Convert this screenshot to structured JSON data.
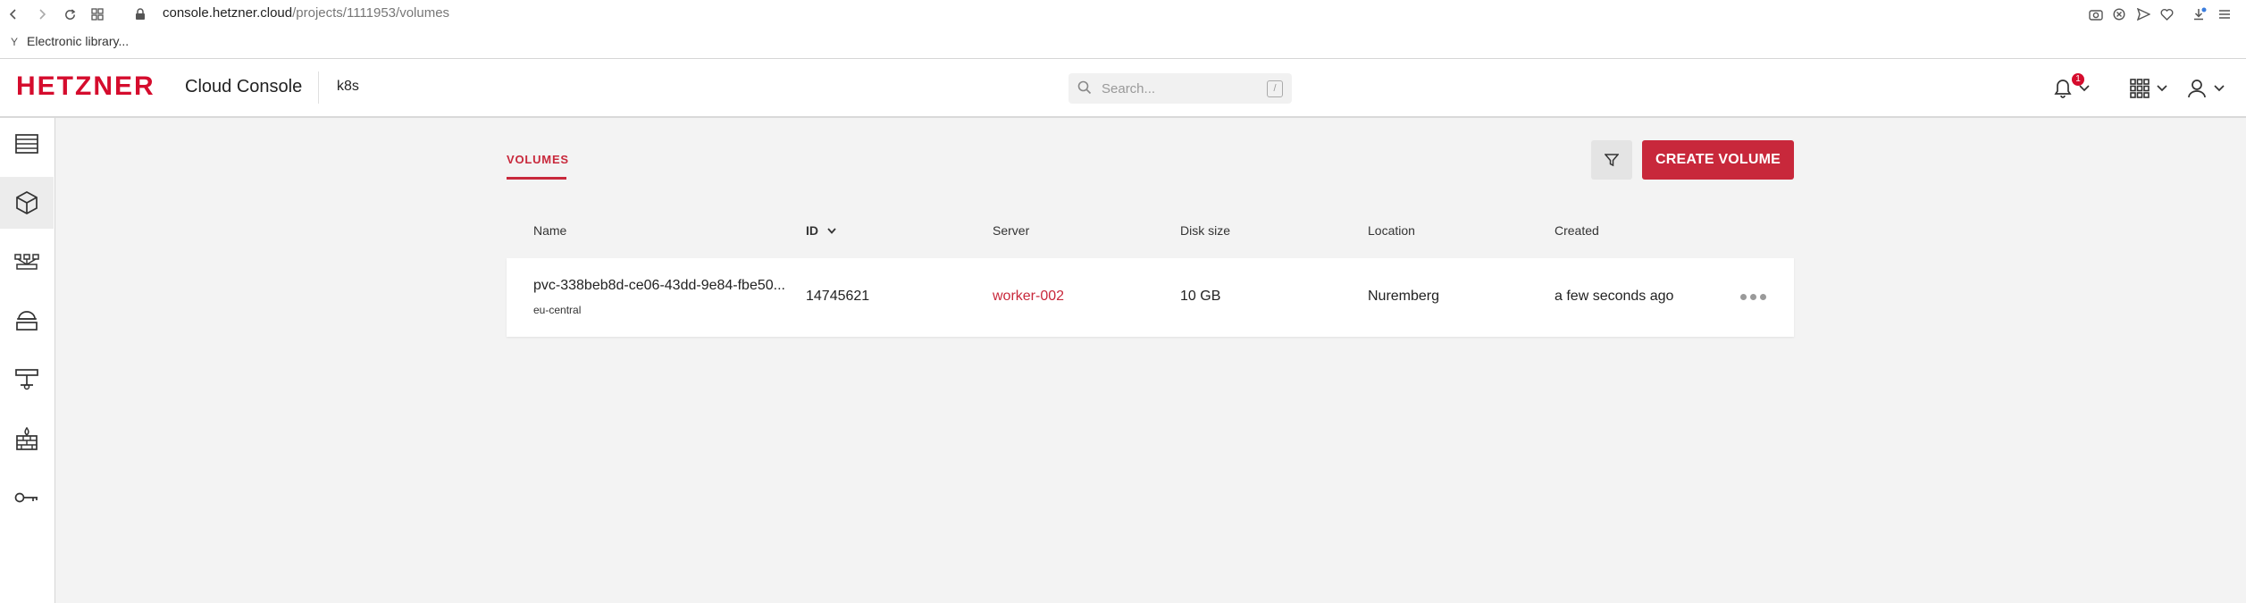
{
  "browser": {
    "url_host": "console.hetzner.cloud",
    "url_path": "/projects/1111953/volumes",
    "bookmark": "Electronic library..."
  },
  "header": {
    "logo": "HETZNER",
    "title": "Cloud Console",
    "project": "k8s",
    "search_placeholder": "Search...",
    "search_shortcut": "/",
    "notification_count": "1"
  },
  "sidebar": {
    "items": [
      {
        "name": "servers",
        "icon": "servers-icon"
      },
      {
        "name": "volumes",
        "icon": "cube-icon",
        "active": true
      },
      {
        "name": "load-balancers",
        "icon": "load-balancer-icon"
      },
      {
        "name": "floating-ips",
        "icon": "floating-ip-icon"
      },
      {
        "name": "networks",
        "icon": "network-icon"
      },
      {
        "name": "firewalls",
        "icon": "firewall-icon"
      },
      {
        "name": "security",
        "icon": "key-icon"
      }
    ]
  },
  "main": {
    "tab": "VOLUMES",
    "create_button": "CREATE VOLUME",
    "columns": [
      "Name",
      "ID",
      "Server",
      "Disk size",
      "Location",
      "Created"
    ],
    "rows": [
      {
        "name": "pvc-338beb8d-ce06-43dd-9e84-fbe50...",
        "region": "eu-central",
        "id": "14745621",
        "server": "worker-002",
        "disk_size": "10 GB",
        "location": "Nuremberg",
        "created": "a few seconds ago"
      }
    ]
  },
  "colors": {
    "brand": "#d50c2d",
    "accent": "#c8283b"
  }
}
